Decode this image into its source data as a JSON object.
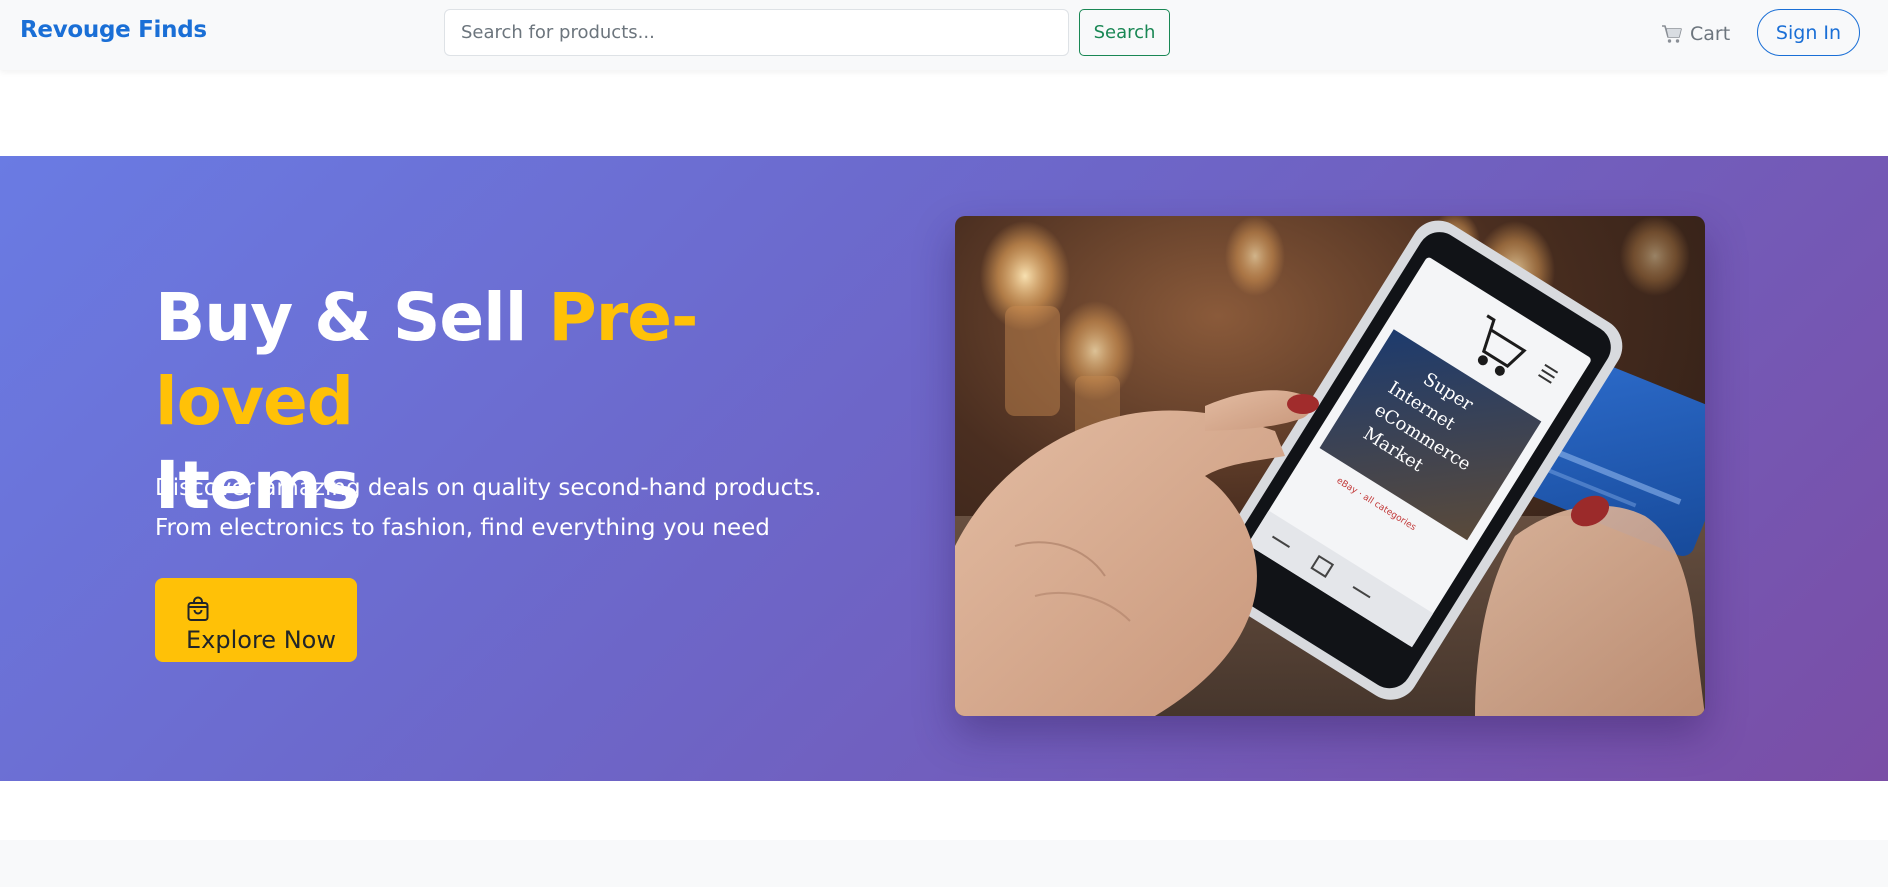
{
  "navbar": {
    "brand": "Revouge Finds",
    "search_placeholder": "Search for products...",
    "search_button": "Search",
    "cart_label": "Cart",
    "cart_icon": "cart-icon",
    "signin_button": "Sign In"
  },
  "hero": {
    "title_part1": "Buy & Sell ",
    "title_accent": "Pre-loved",
    "title_part2": "Items",
    "description": "Discover amazing deals on quality second-hand products. From electronics to fashion, find everything you need",
    "cta_label": "Explore Now",
    "cta_icon": "shopping-bag-icon",
    "image_screen_text": "Super\nInternet\neCommerce\nMarket"
  },
  "colors": {
    "brand": "#1a6fd6",
    "accent": "#ffc107",
    "search_green": "#198754",
    "hero_gradient_start": "#6a7be3",
    "hero_gradient_end": "#7a4ea6"
  }
}
